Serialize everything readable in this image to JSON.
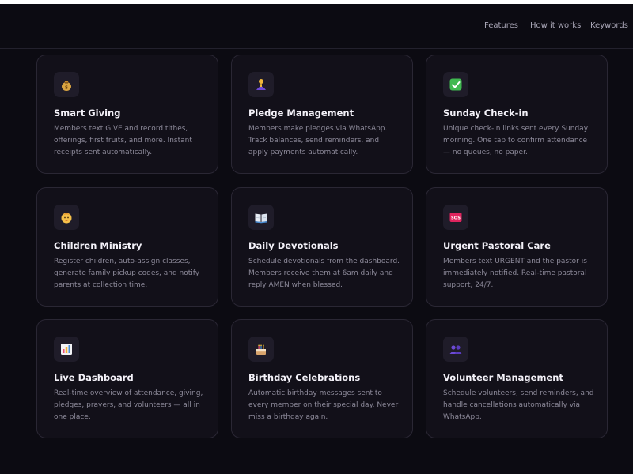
{
  "nav": {
    "links": [
      "Features",
      "How it works",
      "Keywords"
    ]
  },
  "features": [
    {
      "icon": "money-bag-icon",
      "title": "Smart Giving",
      "description": "Members text GIVE and record tithes, offerings, first fruits, and more. Instant receipts sent automatically."
    },
    {
      "icon": "praying-hands-icon",
      "title": "Pledge Management",
      "description": "Members make pledges via WhatsApp. Track balances, send reminders, and apply payments automatically."
    },
    {
      "icon": "check-mark-icon",
      "title": "Sunday Check-in",
      "description": "Unique check-in links sent every Sunday morning. One tap to confirm attendance — no queues, no paper."
    },
    {
      "icon": "baby-icon",
      "title": "Children Ministry",
      "description": "Register children, auto-assign classes, generate family pickup codes, and notify parents at collection time."
    },
    {
      "icon": "open-book-icon",
      "title": "Daily Devotionals",
      "description": "Schedule devotionals from the dashboard. Members receive them at 6am daily and reply AMEN when blessed."
    },
    {
      "icon": "sos-icon",
      "title": "Urgent Pastoral Care",
      "description": "Members text URGENT and the pastor is immediately notified. Real-time pastoral support, 24/7."
    },
    {
      "icon": "bar-chart-icon",
      "title": "Live Dashboard",
      "description": "Real-time overview of attendance, giving, pledges, prayers, and volunteers — all in one place."
    },
    {
      "icon": "birthday-cake-icon",
      "title": "Birthday Celebrations",
      "description": "Automatic birthday messages sent to every member on their special day. Never miss a birthday again."
    },
    {
      "icon": "people-icon",
      "title": "Volunteer Management",
      "description": "Schedule volunteers, send reminders, and handle cancellations automatically via WhatsApp."
    }
  ],
  "sos_label": "SOS"
}
